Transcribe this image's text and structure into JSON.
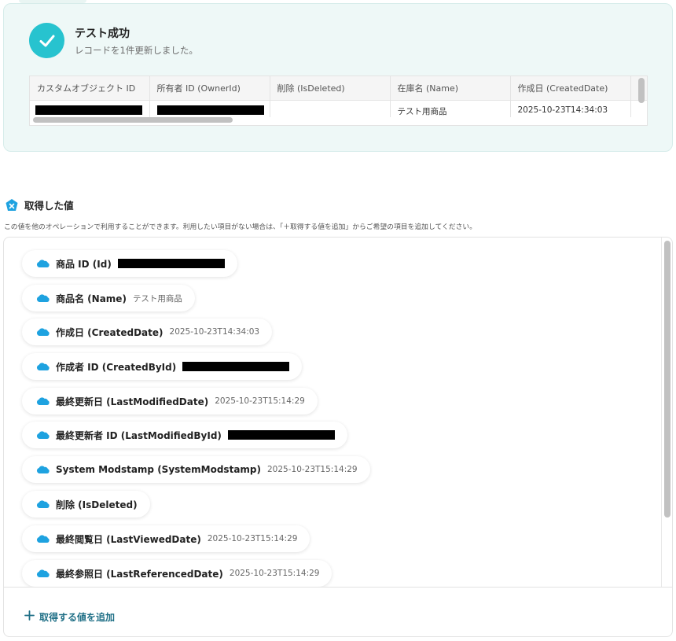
{
  "success": {
    "title": "テスト成功",
    "subtitle": "レコードを1件更新しました。"
  },
  "records_table": {
    "columns": [
      "カスタムオブジェクト ID",
      "所有者 ID (OwnerId)",
      "削除 (IsDeleted)",
      "在庫名 (Name)",
      "作成日 (CreatedDate)"
    ],
    "row": [
      "",
      "",
      "",
      "テスト用商品",
      "2025-10-23T14:34:03"
    ]
  },
  "values_section": {
    "title": "取得した値",
    "description": "この値を他のオペレーションで利用することができます。利用したい項目がない場合は、「＋取得する値を追加」からご希望の項目を追加してください。",
    "items": [
      {
        "label": "商品 ID (Id)",
        "value": "",
        "redacted": true
      },
      {
        "label": "商品名 (Name)",
        "value": "テスト用商品",
        "redacted": false
      },
      {
        "label": "作成日 (CreatedDate)",
        "value": "2025-10-23T14:34:03",
        "redacted": false
      },
      {
        "label": "作成者 ID (CreatedById)",
        "value": "",
        "redacted": true
      },
      {
        "label": "最終更新日 (LastModifiedDate)",
        "value": "2025-10-23T15:14:29",
        "redacted": false
      },
      {
        "label": "最終更新者 ID (LastModifiedById)",
        "value": "",
        "redacted": true
      },
      {
        "label": "System Modstamp (SystemModstamp)",
        "value": "2025-10-23T15:14:29",
        "redacted": false
      },
      {
        "label": "削除 (IsDeleted)",
        "value": "",
        "redacted": false
      },
      {
        "label": "最終閲覧日 (LastViewedDate)",
        "value": "2025-10-23T15:14:29",
        "redacted": false
      },
      {
        "label": "最終参照日 (LastReferencedDate)",
        "value": "2025-10-23T15:14:29",
        "redacted": false
      }
    ],
    "add_label": "取得する値を追加"
  },
  "icons": {
    "success": "check-icon",
    "section": "variable-badge-icon",
    "item": "salesforce-cloud-icon",
    "add": "plus-icon"
  },
  "colors": {
    "accent": "#27c3cf",
    "salesforce": "#1ea2e0",
    "add_link": "#1f6f86",
    "card_bg": "#eef8f7"
  }
}
